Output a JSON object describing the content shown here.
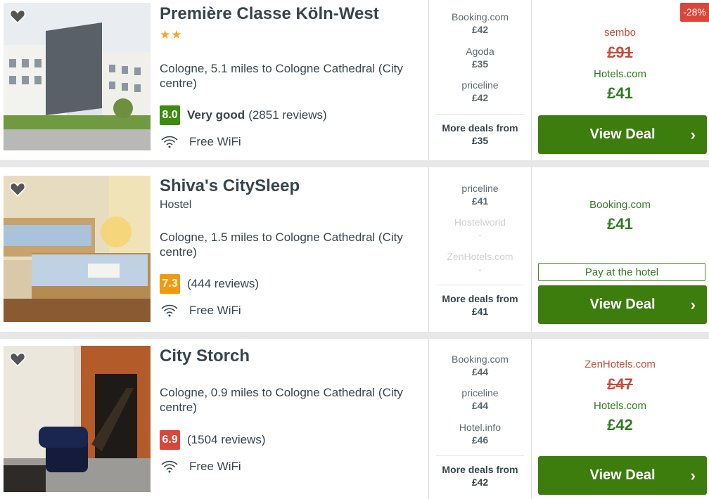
{
  "hotels": [
    {
      "name": "Première Classe Köln-West",
      "stars": "★★",
      "location": "Cologne, 5.1 miles to Cologne Cathedral (City centre)",
      "score": "8.0",
      "score_color": "#3d8b0f",
      "rating_label": "Very good",
      "reviews": "(2851 reviews)",
      "amenity": "Free WiFi",
      "deals": [
        {
          "site": "Booking.com",
          "price": "£42"
        },
        {
          "site": "Agoda",
          "price": "£35"
        },
        {
          "site": "priceline",
          "price": "£42"
        }
      ],
      "more_label": "More deals from",
      "more_price": "£35",
      "badge": "-28%",
      "strike_partner": "sembo",
      "strike_price": "£91",
      "best_partner": "Hotels.com",
      "best_price": "£41",
      "button_label": "View Deal"
    },
    {
      "name": "Shiva's CitySleep",
      "type": "Hostel",
      "location": "Cologne, 1.5 miles to Cologne Cathedral (City centre)",
      "score": "7.3",
      "score_color": "#f29a0f",
      "reviews": "(444 reviews)",
      "amenity": "Free WiFi",
      "deals": [
        {
          "site": "priceline",
          "price": "£41"
        },
        {
          "site": "Hostelworld",
          "price": "-"
        },
        {
          "site": "ZenHotels.com",
          "price": "-"
        }
      ],
      "more_label": "More deals from",
      "more_price": "£41",
      "best_partner": "Booking.com",
      "best_price": "£41",
      "pay_label": "Pay at the hotel",
      "button_label": "View Deal"
    },
    {
      "name": "City Storch",
      "location": "Cologne, 0.9 miles to Cologne Cathedral (City centre)",
      "score": "6.9",
      "score_color": "#d9473b",
      "reviews": "(1504 reviews)",
      "amenity": "Free WiFi",
      "deals": [
        {
          "site": "Booking.com",
          "price": "£44"
        },
        {
          "site": "priceline",
          "price": "£44"
        },
        {
          "site": "Hotel.info",
          "price": "£46"
        }
      ],
      "more_label": "More deals from",
      "more_price": "£42",
      "strike_partner": "ZenHotels.com",
      "strike_price": "£47",
      "best_partner": "Hotels.com",
      "best_price": "£42",
      "button_label": "View Deal"
    }
  ],
  "icons": {
    "favorite": "heart-icon",
    "wifi": "wifi-icon",
    "chevron": "chevron-right-icon"
  }
}
